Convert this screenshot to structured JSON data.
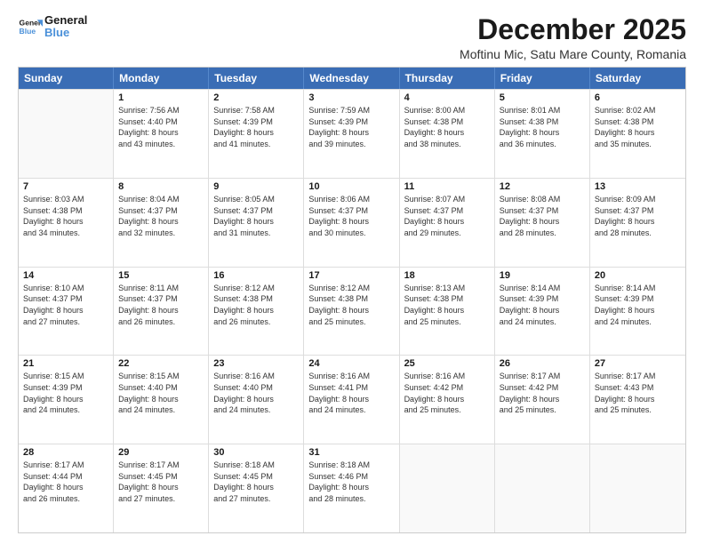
{
  "header": {
    "logo_line1": "General",
    "logo_line2": "Blue",
    "main_title": "December 2025",
    "subtitle": "Moftinu Mic, Satu Mare County, Romania"
  },
  "days_of_week": [
    "Sunday",
    "Monday",
    "Tuesday",
    "Wednesday",
    "Thursday",
    "Friday",
    "Saturday"
  ],
  "weeks": [
    [
      {
        "day": "",
        "info": ""
      },
      {
        "day": "1",
        "info": "Sunrise: 7:56 AM\nSunset: 4:40 PM\nDaylight: 8 hours\nand 43 minutes."
      },
      {
        "day": "2",
        "info": "Sunrise: 7:58 AM\nSunset: 4:39 PM\nDaylight: 8 hours\nand 41 minutes."
      },
      {
        "day": "3",
        "info": "Sunrise: 7:59 AM\nSunset: 4:39 PM\nDaylight: 8 hours\nand 39 minutes."
      },
      {
        "day": "4",
        "info": "Sunrise: 8:00 AM\nSunset: 4:38 PM\nDaylight: 8 hours\nand 38 minutes."
      },
      {
        "day": "5",
        "info": "Sunrise: 8:01 AM\nSunset: 4:38 PM\nDaylight: 8 hours\nand 36 minutes."
      },
      {
        "day": "6",
        "info": "Sunrise: 8:02 AM\nSunset: 4:38 PM\nDaylight: 8 hours\nand 35 minutes."
      }
    ],
    [
      {
        "day": "7",
        "info": "Sunrise: 8:03 AM\nSunset: 4:38 PM\nDaylight: 8 hours\nand 34 minutes."
      },
      {
        "day": "8",
        "info": "Sunrise: 8:04 AM\nSunset: 4:37 PM\nDaylight: 8 hours\nand 32 minutes."
      },
      {
        "day": "9",
        "info": "Sunrise: 8:05 AM\nSunset: 4:37 PM\nDaylight: 8 hours\nand 31 minutes."
      },
      {
        "day": "10",
        "info": "Sunrise: 8:06 AM\nSunset: 4:37 PM\nDaylight: 8 hours\nand 30 minutes."
      },
      {
        "day": "11",
        "info": "Sunrise: 8:07 AM\nSunset: 4:37 PM\nDaylight: 8 hours\nand 29 minutes."
      },
      {
        "day": "12",
        "info": "Sunrise: 8:08 AM\nSunset: 4:37 PM\nDaylight: 8 hours\nand 28 minutes."
      },
      {
        "day": "13",
        "info": "Sunrise: 8:09 AM\nSunset: 4:37 PM\nDaylight: 8 hours\nand 28 minutes."
      }
    ],
    [
      {
        "day": "14",
        "info": "Sunrise: 8:10 AM\nSunset: 4:37 PM\nDaylight: 8 hours\nand 27 minutes."
      },
      {
        "day": "15",
        "info": "Sunrise: 8:11 AM\nSunset: 4:37 PM\nDaylight: 8 hours\nand 26 minutes."
      },
      {
        "day": "16",
        "info": "Sunrise: 8:12 AM\nSunset: 4:38 PM\nDaylight: 8 hours\nand 26 minutes."
      },
      {
        "day": "17",
        "info": "Sunrise: 8:12 AM\nSunset: 4:38 PM\nDaylight: 8 hours\nand 25 minutes."
      },
      {
        "day": "18",
        "info": "Sunrise: 8:13 AM\nSunset: 4:38 PM\nDaylight: 8 hours\nand 25 minutes."
      },
      {
        "day": "19",
        "info": "Sunrise: 8:14 AM\nSunset: 4:39 PM\nDaylight: 8 hours\nand 24 minutes."
      },
      {
        "day": "20",
        "info": "Sunrise: 8:14 AM\nSunset: 4:39 PM\nDaylight: 8 hours\nand 24 minutes."
      }
    ],
    [
      {
        "day": "21",
        "info": "Sunrise: 8:15 AM\nSunset: 4:39 PM\nDaylight: 8 hours\nand 24 minutes."
      },
      {
        "day": "22",
        "info": "Sunrise: 8:15 AM\nSunset: 4:40 PM\nDaylight: 8 hours\nand 24 minutes."
      },
      {
        "day": "23",
        "info": "Sunrise: 8:16 AM\nSunset: 4:40 PM\nDaylight: 8 hours\nand 24 minutes."
      },
      {
        "day": "24",
        "info": "Sunrise: 8:16 AM\nSunset: 4:41 PM\nDaylight: 8 hours\nand 24 minutes."
      },
      {
        "day": "25",
        "info": "Sunrise: 8:16 AM\nSunset: 4:42 PM\nDaylight: 8 hours\nand 25 minutes."
      },
      {
        "day": "26",
        "info": "Sunrise: 8:17 AM\nSunset: 4:42 PM\nDaylight: 8 hours\nand 25 minutes."
      },
      {
        "day": "27",
        "info": "Sunrise: 8:17 AM\nSunset: 4:43 PM\nDaylight: 8 hours\nand 25 minutes."
      }
    ],
    [
      {
        "day": "28",
        "info": "Sunrise: 8:17 AM\nSunset: 4:44 PM\nDaylight: 8 hours\nand 26 minutes."
      },
      {
        "day": "29",
        "info": "Sunrise: 8:17 AM\nSunset: 4:45 PM\nDaylight: 8 hours\nand 27 minutes."
      },
      {
        "day": "30",
        "info": "Sunrise: 8:18 AM\nSunset: 4:45 PM\nDaylight: 8 hours\nand 27 minutes."
      },
      {
        "day": "31",
        "info": "Sunrise: 8:18 AM\nSunset: 4:46 PM\nDaylight: 8 hours\nand 28 minutes."
      },
      {
        "day": "",
        "info": ""
      },
      {
        "day": "",
        "info": ""
      },
      {
        "day": "",
        "info": ""
      }
    ]
  ]
}
